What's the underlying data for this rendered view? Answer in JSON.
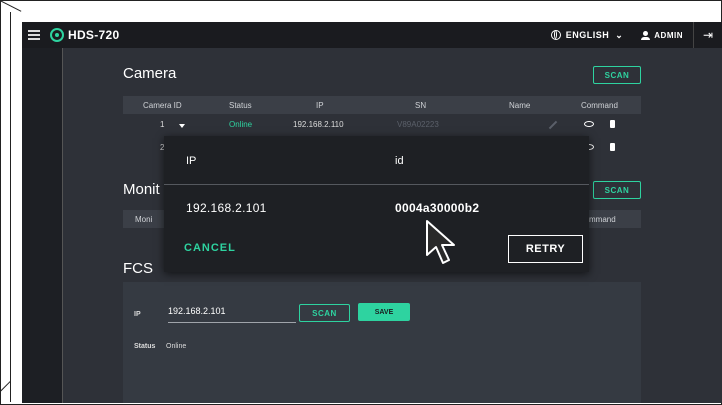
{
  "header": {
    "title": "HDS-720",
    "language": "ENGLISH",
    "user": "ADMIN"
  },
  "camera": {
    "title": "Camera",
    "scan_label": "SCAN",
    "columns": [
      "Camera ID",
      "Status",
      "IP",
      "SN",
      "Name",
      "Command"
    ],
    "rows": [
      {
        "id": "1",
        "status": "Online",
        "ip": "192.168.2.110",
        "sn": "V89A02223"
      },
      {
        "id": "2",
        "status": "",
        "ip": "",
        "sn": ""
      }
    ]
  },
  "monitor": {
    "title": "Monit",
    "scan_label": "SCAN",
    "col_first": "Moni",
    "col_last": "mmand"
  },
  "fcs": {
    "title": "FCS",
    "ip_label": "IP",
    "ip_value": "192.168.2.101",
    "scan_label": "SCAN",
    "save_label": "SAVE",
    "status_label": "Status",
    "status_value": "Online"
  },
  "dialog": {
    "col_ip": "IP",
    "col_id": "id",
    "ip_value": "192.168.2.101",
    "id_value": "0004a30000b2",
    "cancel_label": "CANCEL",
    "retry_label": "RETRY"
  },
  "colors": {
    "accent": "#2ed3a0",
    "background": "#2e3138",
    "topbar": "#1a1b1f",
    "dialog": "#1e2024"
  }
}
